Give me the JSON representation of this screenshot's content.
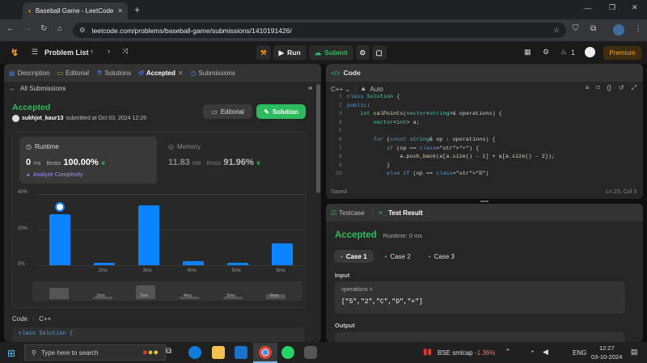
{
  "browser": {
    "tab_title": "Baseball Game - LeetCode",
    "url": "leetcode.com/problems/baseball-game/submissions/1410191426/"
  },
  "header": {
    "problem_list": "Problem List",
    "run": "Run",
    "submit": "Submit",
    "fire_count": "1",
    "premium": "Premium"
  },
  "left_tabs": [
    "Description",
    "Editorial",
    "Solutions",
    "Accepted",
    "Submissions"
  ],
  "submission": {
    "back_label": "All Submissions",
    "status": "Accepted",
    "user": "sukhjot_kaur13",
    "submitted_text": "submitted at Oct 03, 2024 12:26",
    "editorial_btn": "Editorial",
    "solution_btn": "Solution",
    "runtime_label": "Runtime",
    "runtime_value": "0",
    "runtime_unit": "ms",
    "beats_label": "Beats",
    "runtime_beats": "100.00%",
    "analyze": "Analyze Complexity",
    "memory_label": "Memory",
    "memory_value": "11.83",
    "memory_unit": "MB",
    "memory_beats": "91.96%",
    "code_label": "Code",
    "code_lang": "C++",
    "code_preview": "class Solution {"
  },
  "chart_data": {
    "type": "bar",
    "y_ticks": [
      "40%",
      "20%",
      "0%"
    ],
    "ylim": [
      0,
      40
    ],
    "categories": [
      "0ms",
      "2ms",
      "3ms",
      "4ms",
      "5ms",
      "6ms"
    ],
    "values": [
      28.5,
      1.2,
      33.5,
      2.5,
      1.2,
      12.3
    ],
    "series": [
      {
        "values": [
          28.5,
          1.2,
          33.5,
          2.5,
          1.2,
          12.3
        ]
      }
    ],
    "x_labels_shown": [
      "",
      "2ms",
      "3ms",
      "4ms",
      "5ms",
      "6ms"
    ],
    "highlight_category": "0ms",
    "bar_color": "#0a84ff"
  },
  "code_panel": {
    "title": "Code",
    "lang": "C++",
    "mode": "Auto",
    "saved": "Saved",
    "cursor": "Ln 23, Col 3"
  },
  "code_lines": [
    "class Solution {",
    "public:",
    "    int calPoints(vector<string>& operations) {",
    "        vector<int> a;",
    "",
    "        for (const string& op : operations) {",
    "            if (op == \"+\") {",
    "                a.push_back(a[a.size() - 1] + a[a.size() - 2]);",
    "            }",
    "            else if (op == \"D\")"
  ],
  "result_panel": {
    "testcase_tab": "Testcase",
    "result_tab": "Test Result",
    "status": "Accepted",
    "runtime": "Runtime: 0 ms",
    "cases": [
      "Case 1",
      "Case 2",
      "Case 3"
    ],
    "input_label": "Input",
    "param_name": "operations =",
    "param_value": "[\"5\",\"2\",\"C\",\"D\",\"+\"]",
    "output_label": "Output"
  },
  "taskbar": {
    "search_placeholder": "Type here to search",
    "stock_name": "BSE smlcap",
    "stock_change": "-1.36%",
    "lang": "ENG",
    "time": "12:27",
    "date": "03-10-2024"
  }
}
